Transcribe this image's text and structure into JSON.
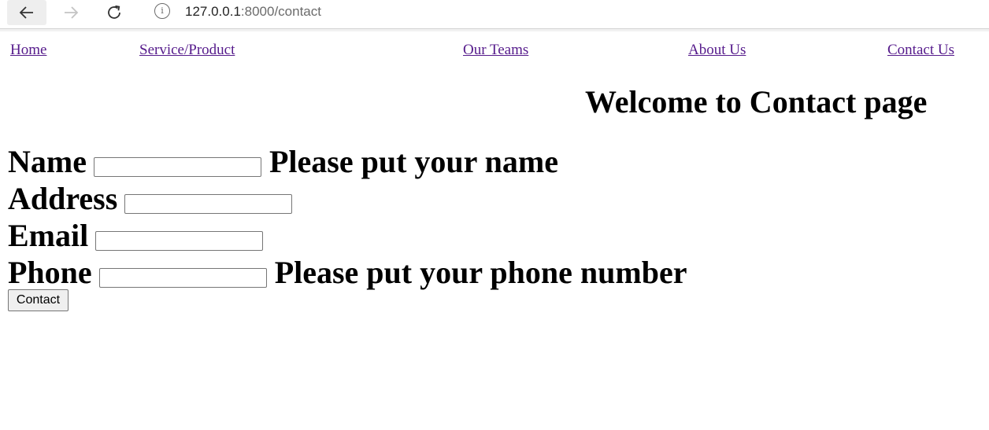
{
  "browser": {
    "url_host": "127.0.0.1",
    "url_rest": ":8000/contact"
  },
  "nav": {
    "links": [
      {
        "label": "Home"
      },
      {
        "label": "Service/Product"
      },
      {
        "label": "Our Teams"
      },
      {
        "label": "About Us"
      },
      {
        "label": "Contact Us"
      }
    ],
    "link_color": "#551a8b"
  },
  "page": {
    "title": "Welcome to Contact page"
  },
  "form": {
    "fields": [
      {
        "label": "Name",
        "value": "",
        "hint": "Please put your name"
      },
      {
        "label": "Address",
        "value": ""
      },
      {
        "label": "Email",
        "value": ""
      },
      {
        "label": "Phone",
        "value": "",
        "hint": "Please put your phone number"
      }
    ],
    "submit_label": "Contact"
  }
}
